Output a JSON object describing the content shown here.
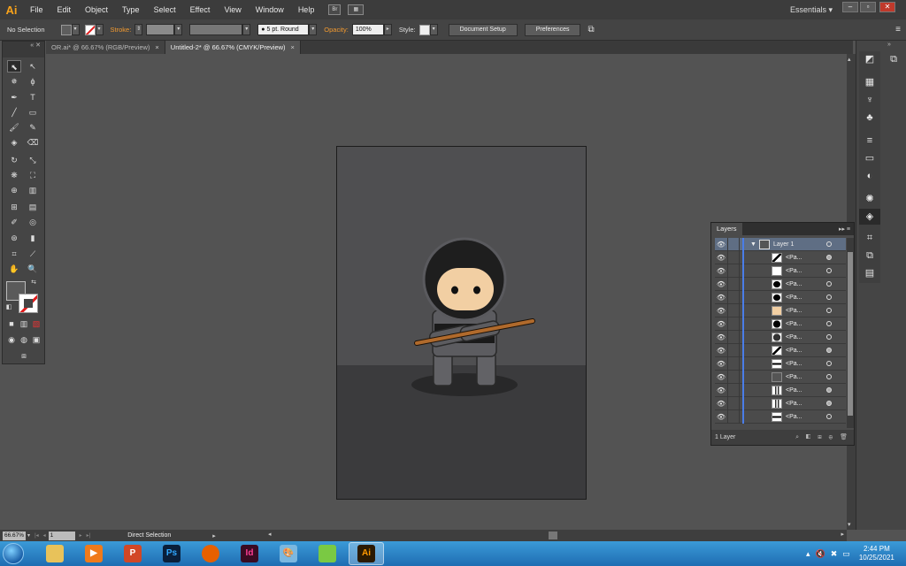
{
  "menubar": {
    "logo": "Ai",
    "items": [
      "File",
      "Edit",
      "Object",
      "Type",
      "Select",
      "Effect",
      "View",
      "Window",
      "Help"
    ],
    "bridge_button": "Br",
    "workspace": "Essentials",
    "workspace_arrow": "▾",
    "window_buttons": [
      "–",
      "▫",
      "✕"
    ]
  },
  "controlbar": {
    "selection_label": "No Selection",
    "stroke_label": "Stroke:",
    "brush_value": "5 pt. Round",
    "opacity_label": "Opacity:",
    "opacity_value": "100%",
    "style_label": "Style:",
    "document_setup": "Document Setup",
    "preferences": "Preferences"
  },
  "tabs": [
    {
      "label": "OR.ai* @ 66.67% (RGB/Preview)",
      "close": "×"
    },
    {
      "label": "Untitled-2* @ 66.67% (CMYK/Preview)",
      "close": "×"
    }
  ],
  "tools_head": "«  ✕",
  "layers": {
    "tab": "Layers",
    "menu": "▸▸  ≡",
    "top_layer": "Layer 1",
    "twirl": "▼",
    "path_label": "<Pa...",
    "rows_count_label": "1 Layer",
    "footer_icons": "⌕ ◧ ⊞ ⊕ 🗑",
    "sublayers": [
      {
        "thumb": "diag",
        "target": "filled"
      },
      {
        "thumb": "white",
        "target": "empty"
      },
      {
        "thumb": "black-ellipse",
        "target": "empty"
      },
      {
        "thumb": "black-ellipse",
        "target": "empty"
      },
      {
        "thumb": "skin",
        "target": "empty"
      },
      {
        "thumb": "black-round",
        "target": "empty"
      },
      {
        "thumb": "dark-round",
        "target": "empty"
      },
      {
        "thumb": "diag",
        "target": "filled"
      },
      {
        "thumb": "bar",
        "target": "empty"
      },
      {
        "thumb": "gray",
        "target": "empty"
      },
      {
        "thumb": "legs",
        "target": "filled"
      },
      {
        "thumb": "legs",
        "target": "filled"
      },
      {
        "thumb": "bar",
        "target": "empty"
      }
    ]
  },
  "statusbar": {
    "zoom": "66.67%",
    "page": "1",
    "tool": "Direct Selection"
  },
  "taskbar": {
    "apps": [
      {
        "name": "file-explorer",
        "label": "",
        "bg": "#e8c25a",
        "fg": "#7a5a10"
      },
      {
        "name": "media-player",
        "label": "▶",
        "bg": "#f07a1a",
        "fg": "#ffffff"
      },
      {
        "name": "powerpoint",
        "label": "P",
        "bg": "#d24726",
        "fg": "#ffffff"
      },
      {
        "name": "photoshop",
        "label": "Ps",
        "bg": "#0a1f3a",
        "fg": "#31a8ff"
      },
      {
        "name": "firefox",
        "label": "",
        "bg": "#e66000",
        "fg": "#ffffff"
      },
      {
        "name": "indesign",
        "label": "Id",
        "bg": "#3a0b22",
        "fg": "#ff3d94"
      },
      {
        "name": "paint",
        "label": "🎨",
        "bg": "#7bb8e0",
        "fg": "#ffffff"
      },
      {
        "name": "green-app",
        "label": "",
        "bg": "#7ac943",
        "fg": "#ffffff"
      },
      {
        "name": "illustrator",
        "label": "Ai",
        "bg": "#2b1a02",
        "fg": "#ff9a00"
      }
    ],
    "clock_time": "2:44 PM",
    "clock_date": "10/25/2021"
  },
  "colors": {
    "accent": "#f7a21b",
    "layer_highlight": "#5f6e84",
    "layer_bar": "#4a7de8"
  }
}
